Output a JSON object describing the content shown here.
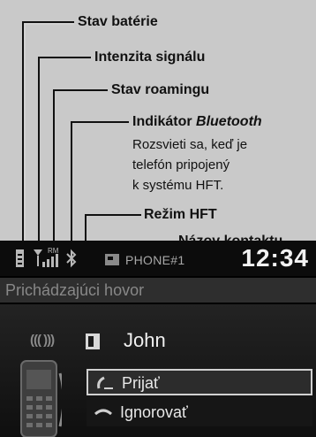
{
  "callouts": {
    "battery": "Stav batérie",
    "signal": "Intenzita signálu",
    "roaming": "Stav roamingu",
    "bluetooth_prefix": "Indikátor ",
    "bluetooth_italic": "Bluetooth",
    "bluetooth_desc": [
      "Rozsvieti sa, keď je",
      "telefón pripojený",
      "k systému HFT."
    ],
    "hft_mode": "Režim HFT",
    "contact_name": "Názov kontaktu"
  },
  "screen": {
    "roaming_badge": "RM",
    "phone_name": "PHONE#1",
    "clock": "12:34",
    "incoming_text": "Prichádzajúci hovor",
    "wave_icon": "((( )))",
    "contact": "John",
    "accept_label": "Prijať",
    "ignore_label": "Ignorovať"
  },
  "icons": [
    "battery-icon",
    "signal-strength-icon",
    "bluetooth-icon",
    "phone-icon",
    "contact-card-icon",
    "handset-icon",
    "accept-call-icon",
    "ignore-call-icon"
  ],
  "colors": {
    "background": "#c9c9c9",
    "screen": "#000000",
    "highlight_border": "#d0d0d0"
  }
}
